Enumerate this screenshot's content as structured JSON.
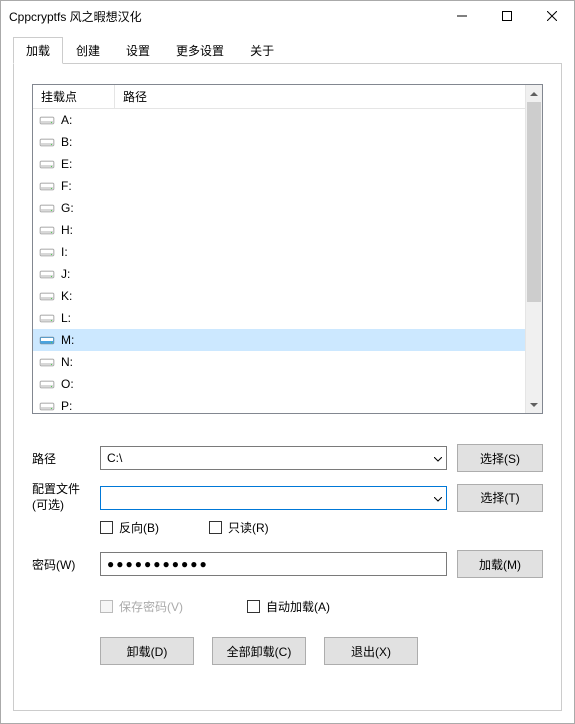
{
  "window": {
    "title": "Cppcryptfs 风之暇想汉化"
  },
  "tabs": {
    "items": [
      {
        "label": "加载",
        "active": true
      },
      {
        "label": "创建",
        "active": false
      },
      {
        "label": "设置",
        "active": false
      },
      {
        "label": "更多设置",
        "active": false
      },
      {
        "label": "关于",
        "active": false
      }
    ]
  },
  "list": {
    "headers": [
      "挂载点",
      "路径"
    ],
    "drives": [
      {
        "letter": "A:",
        "selected": false
      },
      {
        "letter": "B:",
        "selected": false
      },
      {
        "letter": "E:",
        "selected": false
      },
      {
        "letter": "F:",
        "selected": false
      },
      {
        "letter": "G:",
        "selected": false
      },
      {
        "letter": "H:",
        "selected": false
      },
      {
        "letter": "I:",
        "selected": false
      },
      {
        "letter": "J:",
        "selected": false
      },
      {
        "letter": "K:",
        "selected": false
      },
      {
        "letter": "L:",
        "selected": false
      },
      {
        "letter": "M:",
        "selected": true
      },
      {
        "letter": "N:",
        "selected": false
      },
      {
        "letter": "O:",
        "selected": false
      },
      {
        "letter": "P:",
        "selected": false
      }
    ]
  },
  "form": {
    "path_label": "路径",
    "path_value": "C:\\",
    "config_label": "配置文件(可选)",
    "config_value": "",
    "password_label": "密码(W)",
    "password_value": "●●●●●●●●●●●",
    "select_s": "选择(S)",
    "select_t": "选择(T)",
    "mount": "加载(M)",
    "reverse": "反向(B)",
    "readonly": "只读(R)",
    "save_pwd": "保存密码(V)",
    "auto_mount": "自动加载(A)",
    "dismount": "卸载(D)",
    "dismount_all": "全部卸载(C)",
    "exit": "退出(X)"
  }
}
